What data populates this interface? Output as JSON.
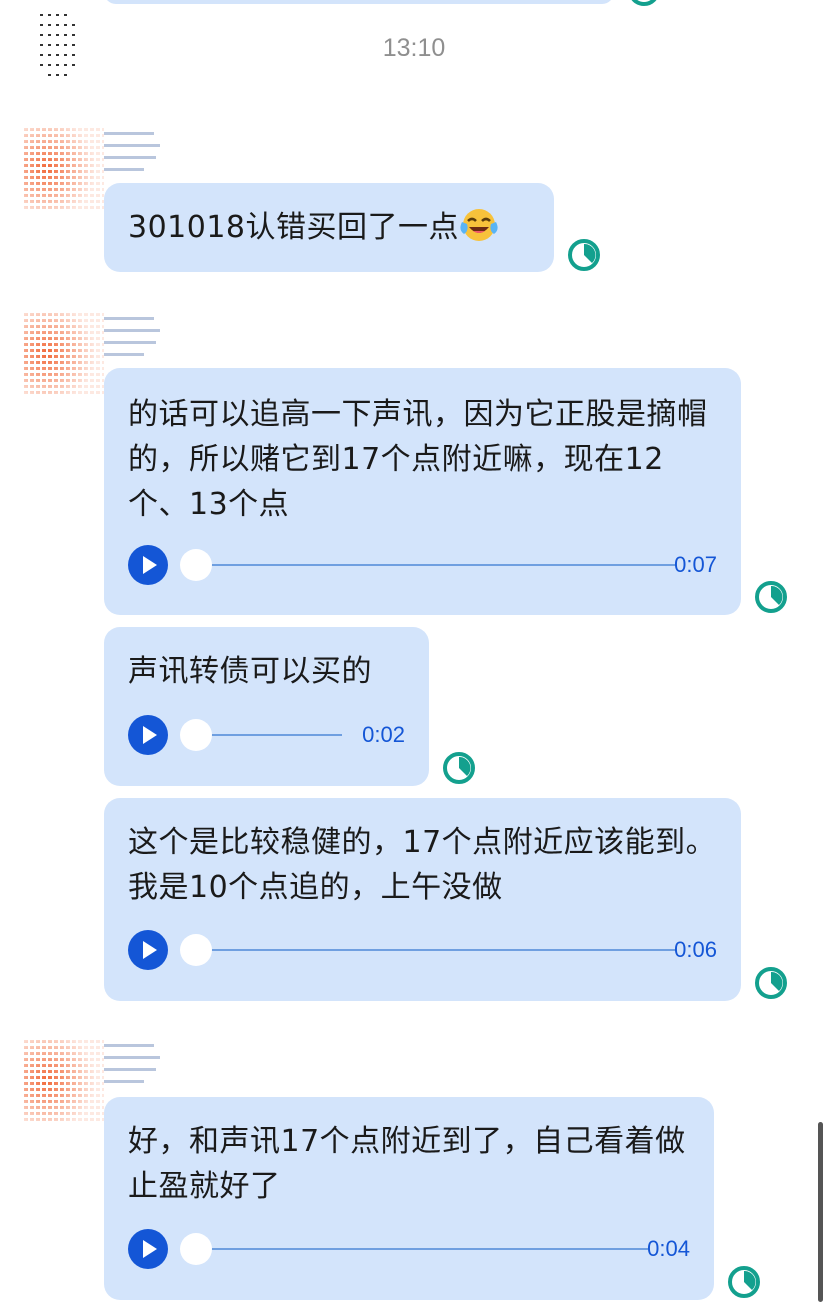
{
  "timestamp": "13:10",
  "messages": [
    {
      "text": "301018认错买回了一点"
    },
    {
      "text": "的话可以追高一下声讯，因为它正股是摘帽的，所以赌它到17个点附近嘛，现在12个、13个点",
      "duration": "0:07"
    },
    {
      "text": "声讯转债可以买的",
      "duration": "0:02"
    },
    {
      "text": "这个是比较稳健的，17个点附近应该能到。我是10个点追的，上午没做",
      "duration": "0:06"
    },
    {
      "text": "好，和声讯17个点附近到了，自己看着做止盈就好了",
      "duration": "0:04"
    }
  ],
  "colors": {
    "bubble": "#d3e4fb",
    "play": "#1456d6",
    "status": "#13a08e",
    "timestamp": "#8f8f8f"
  },
  "icons": [
    "avatar",
    "play-icon",
    "read-status-icon",
    "crying-laughing-emoji"
  ]
}
